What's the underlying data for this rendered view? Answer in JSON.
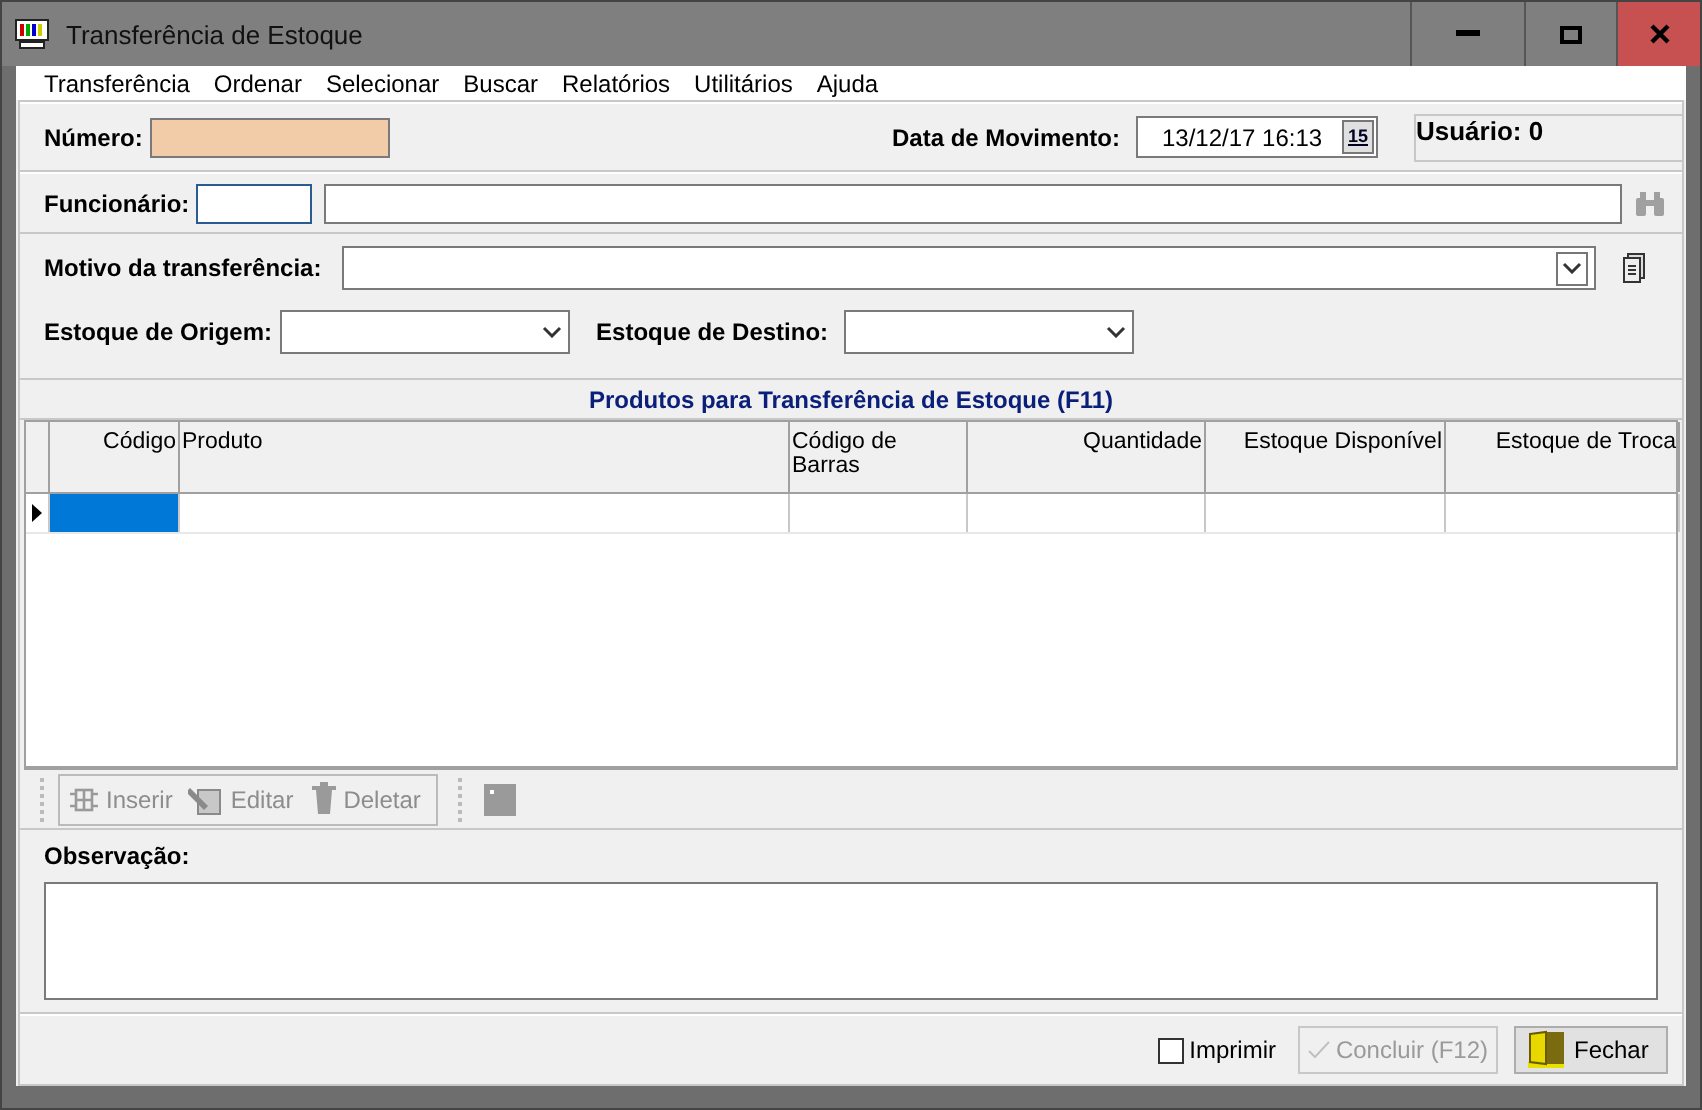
{
  "window": {
    "title": "Transferência de Estoque"
  },
  "menu": [
    {
      "label": "Transferência"
    },
    {
      "label": "Ordenar"
    },
    {
      "label": "Selecionar"
    },
    {
      "label": "Buscar"
    },
    {
      "label": "Relatórios"
    },
    {
      "label": "Utilitários"
    },
    {
      "label": "Ajuda"
    }
  ],
  "form": {
    "numero": {
      "label": "Número:"
    },
    "data_movimento": {
      "label": "Data de Movimento:",
      "value": "13/12/17 16:13",
      "calendar_label": "15"
    },
    "usuario": "Usuário: 0",
    "funcionario": {
      "label": "Funcionário:"
    },
    "motivo": {
      "label": "Motivo da transferência:"
    },
    "estoque_origem": {
      "label": "Estoque de Origem:"
    },
    "estoque_destino": {
      "label": "Estoque de Destino:"
    }
  },
  "grid": {
    "title": "Produtos para Transferência de Estoque (F11)",
    "columns": [
      {
        "label": "Código",
        "kind": "number"
      },
      {
        "label": "Produto",
        "kind": "text"
      },
      {
        "label": "Código de Barras",
        "kind": "text"
      },
      {
        "label": "Quantidade",
        "kind": "number"
      },
      {
        "label": "Estoque Disponível",
        "kind": "number"
      },
      {
        "label": "Estoque de Troca",
        "kind": "number"
      }
    ],
    "rows": [
      {
        "selected": true
      }
    ]
  },
  "toolbar": {
    "buttons": [
      {
        "label": "Inserir",
        "disabled": true,
        "kind": "insert"
      },
      {
        "label": "Editar",
        "disabled": true,
        "kind": "edit"
      },
      {
        "label": "Deletar",
        "disabled": true,
        "kind": "delete"
      }
    ]
  },
  "observacao": {
    "label": "Observação:"
  },
  "footer": {
    "imprimir": {
      "label": "Imprimir",
      "checked": false
    },
    "buttons": [
      {
        "label": "Concluir (F12)",
        "disabled": true,
        "kind": "confirm"
      },
      {
        "label": "Fechar",
        "disabled": false,
        "kind": "close"
      }
    ]
  }
}
